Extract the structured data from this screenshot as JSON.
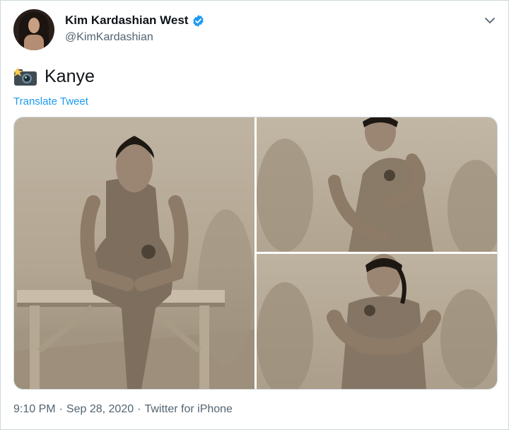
{
  "author": {
    "display_name": "Kim Kardashian West",
    "handle": "@KimKardashian",
    "verified": true,
    "verified_color": "#1d9bf0"
  },
  "tweet": {
    "emoji": "camera-with-flash-icon",
    "text": "Kanye",
    "translate_label": "Translate Tweet",
    "media_count": 3
  },
  "meta": {
    "time": "9:10 PM",
    "separator": "·",
    "date": "Sep 28, 2020",
    "source": "Twitter for iPhone"
  },
  "colors": {
    "link": "#1d9bf0",
    "secondary_text": "#536471",
    "primary_text": "#0f1419"
  }
}
